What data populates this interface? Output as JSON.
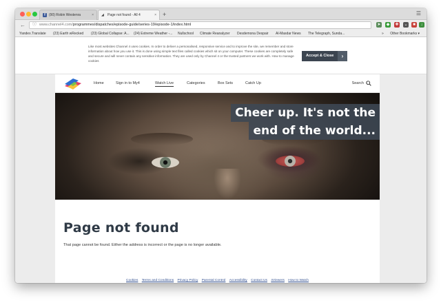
{
  "browser": {
    "tabs": [
      {
        "label": "(90) Robin Westenra",
        "close": "×"
      },
      {
        "label": "Page not found - All 4",
        "close": "×"
      }
    ],
    "new_tab": "+",
    "menu_icon": "hamburger-icon",
    "url_host": "www.channel4.com/",
    "url_path": "programmes/dispatches/episode-guide/series-19/episode-1/index.html",
    "bookmarks": [
      "Yandex.Translate",
      "(23) Earth wRecked",
      "(23) Global Collapse: A...",
      "(24) Extreme Weather -...",
      "Nullschool",
      "Climate Reanalyzer",
      "Desdemona Despair",
      "Al-Masdar News",
      "The Telegraph, Sunda..."
    ],
    "bookmarks_overflow": "»",
    "other_bookmarks": "Other Bookmarks ▾"
  },
  "cookie_banner": {
    "text": "Like most websites Channel 4 uses cookies. In order to deliver a personalised, responsive service and to improve the site, we remember and store information about how you use it. This is done using simple text files called cookies which sit on your computer. These cookies are completely safe and secure and will never contain any sensitive information. They are used only by Channel 4 or the trusted partners we work with. How to manage cookies",
    "button": "Accept & Close"
  },
  "nav": {
    "items": [
      "Home",
      "Sign in to My4",
      "Watch Live",
      "Categories",
      "Box Sets",
      "Catch Up"
    ],
    "search": "Search"
  },
  "hero": {
    "line1": "Cheer up. It's not the",
    "line2": "end of the world..."
  },
  "main": {
    "title": "Page not found",
    "message": "That page cannot be found. Either the address is incorrect or the page is no longer available."
  },
  "footer": {
    "links": [
      "Cookies",
      "Terms and Conditions",
      "Privacy Policy",
      "Parental Control",
      "Accessibility",
      "Contact Us",
      "4Viewers",
      "How to Watch"
    ]
  },
  "colors": {
    "accent": "#3c4550",
    "hero_text_bg": "#3e4854",
    "title": "#2f3a46",
    "link": "#2c4a8c"
  }
}
